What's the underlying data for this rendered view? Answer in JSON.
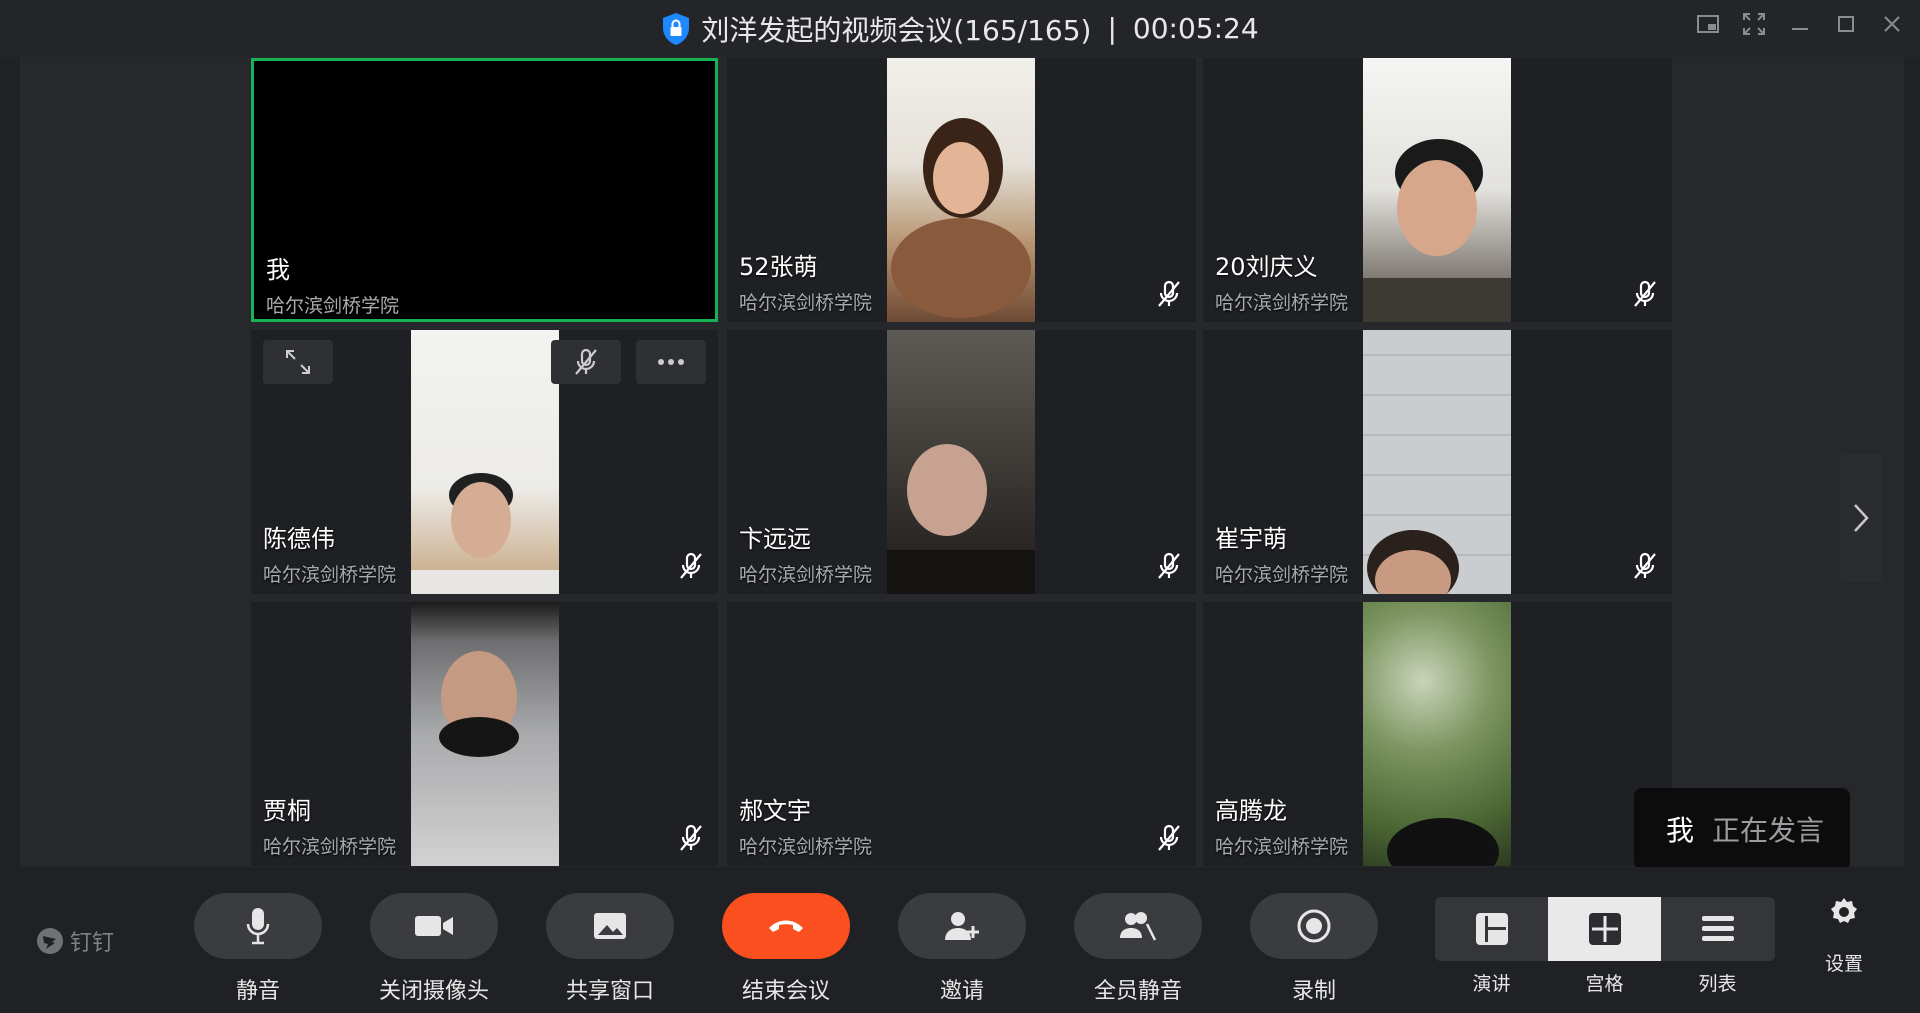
{
  "window": {
    "title": "刘洋发起的视频会议(165/165)",
    "separator": "|",
    "timer": "00:05:24"
  },
  "tiles": [
    {
      "name": "我",
      "org": "哈尔滨剑桥学院"
    },
    {
      "name": "52张萌",
      "org": "哈尔滨剑桥学院"
    },
    {
      "name": "20刘庆义",
      "org": "哈尔滨剑桥学院"
    },
    {
      "name": "陈德伟",
      "org": "哈尔滨剑桥学院"
    },
    {
      "name": "卞远远",
      "org": "哈尔滨剑桥学院"
    },
    {
      "name": "崔宇萌",
      "org": "哈尔滨剑桥学院"
    },
    {
      "name": "贾桐",
      "org": "哈尔滨剑桥学院"
    },
    {
      "name": "郝文宇",
      "org": "哈尔滨剑桥学院"
    },
    {
      "name": "高腾龙",
      "org": "哈尔滨剑桥学院"
    }
  ],
  "speaking": {
    "who": "我",
    "status": "正在发言"
  },
  "toolbar": {
    "logo": "钉钉",
    "mute": "静音",
    "camera": "关闭摄像头",
    "share": "共享窗口",
    "end": "结束会议",
    "invite": "邀请",
    "mute_all": "全员静音",
    "record": "录制",
    "views": [
      "演讲",
      "宫格",
      "列表"
    ],
    "settings": "设置"
  },
  "colors": {
    "active_border": "#17b253",
    "end_button": "#fb4f20",
    "shield": "#1e88ff"
  }
}
